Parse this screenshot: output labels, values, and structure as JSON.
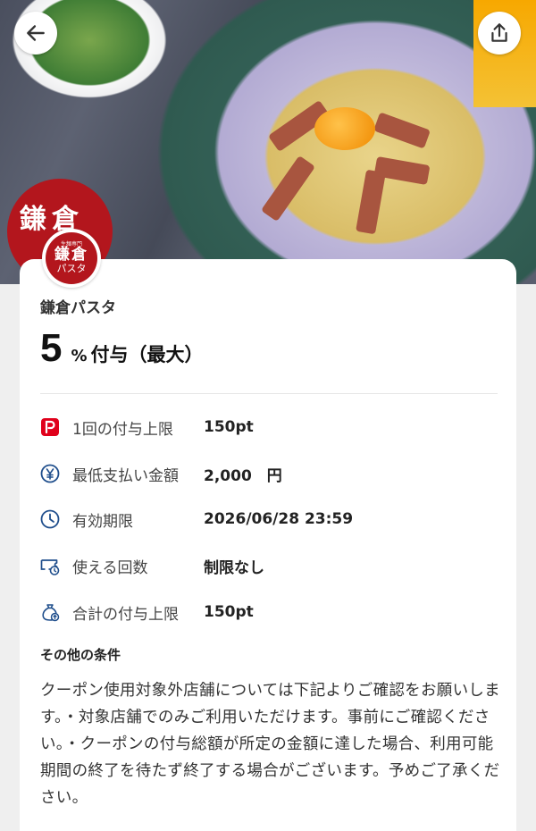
{
  "header": {
    "back_icon": "arrow-left-icon",
    "share_icon": "share-icon"
  },
  "merchant": {
    "name": "鎌倉パスタ",
    "logo_small_text": "生麺専門",
    "logo_main_text": "鎌倉",
    "logo_sub_text": "パスタ"
  },
  "reward": {
    "rate": "5",
    "unit": "%",
    "label": "付与（最大）"
  },
  "details": [
    {
      "icon": "paypay-p-icon",
      "label": "1回の付与上限",
      "value": "150pt"
    },
    {
      "icon": "yen-coin-icon",
      "label": "最低支払い金額",
      "value": "2,000　円"
    },
    {
      "icon": "clock-icon",
      "label": "有効期限",
      "value": "2026/06/28 23:59"
    },
    {
      "icon": "ticket-count-icon",
      "label": "使える回数",
      "value": "制限なし"
    },
    {
      "icon": "money-bag-icon",
      "label": "合計の付与上限",
      "value": "150pt"
    }
  ],
  "conditions": {
    "title": "その他の条件",
    "body": "クーポン使用対象外店舗については下記よりご確認をお願いします。・対象店舗でのみご利用いただけます。事前にご確認ください。・クーポンの付与総額が所定の金額に達した場合、利用可能期間の終了を待たず終了する場合がございます。予めご了承ください。"
  },
  "colors": {
    "accent_red": "#e0001b",
    "icon_blue": "#1f4e8c",
    "brand_red": "#b3161d"
  }
}
